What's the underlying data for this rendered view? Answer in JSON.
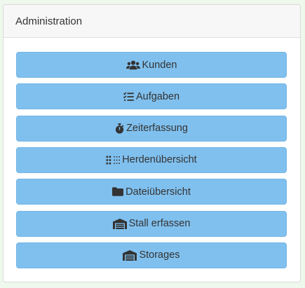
{
  "panel": {
    "title": "Administration"
  },
  "buttons": [
    {
      "label": "Kunden",
      "icon": "users-icon"
    },
    {
      "label": "Aufgaben",
      "icon": "task-list-icon"
    },
    {
      "label": "Zeiterfassung",
      "icon": "stopwatch-icon"
    },
    {
      "label": "Herdenübersicht",
      "icon": "grid-dots-icon"
    },
    {
      "label": "Dateiübersicht",
      "icon": "folder-icon"
    },
    {
      "label": "Stall erfassen",
      "icon": "warehouse-icon"
    },
    {
      "label": "Storages",
      "icon": "warehouse-icon"
    }
  ],
  "colors": {
    "button_bg": "#80c0ee",
    "header_bg": "#f7f7f7",
    "page_bg": "#eef8ec",
    "text": "#333333"
  }
}
